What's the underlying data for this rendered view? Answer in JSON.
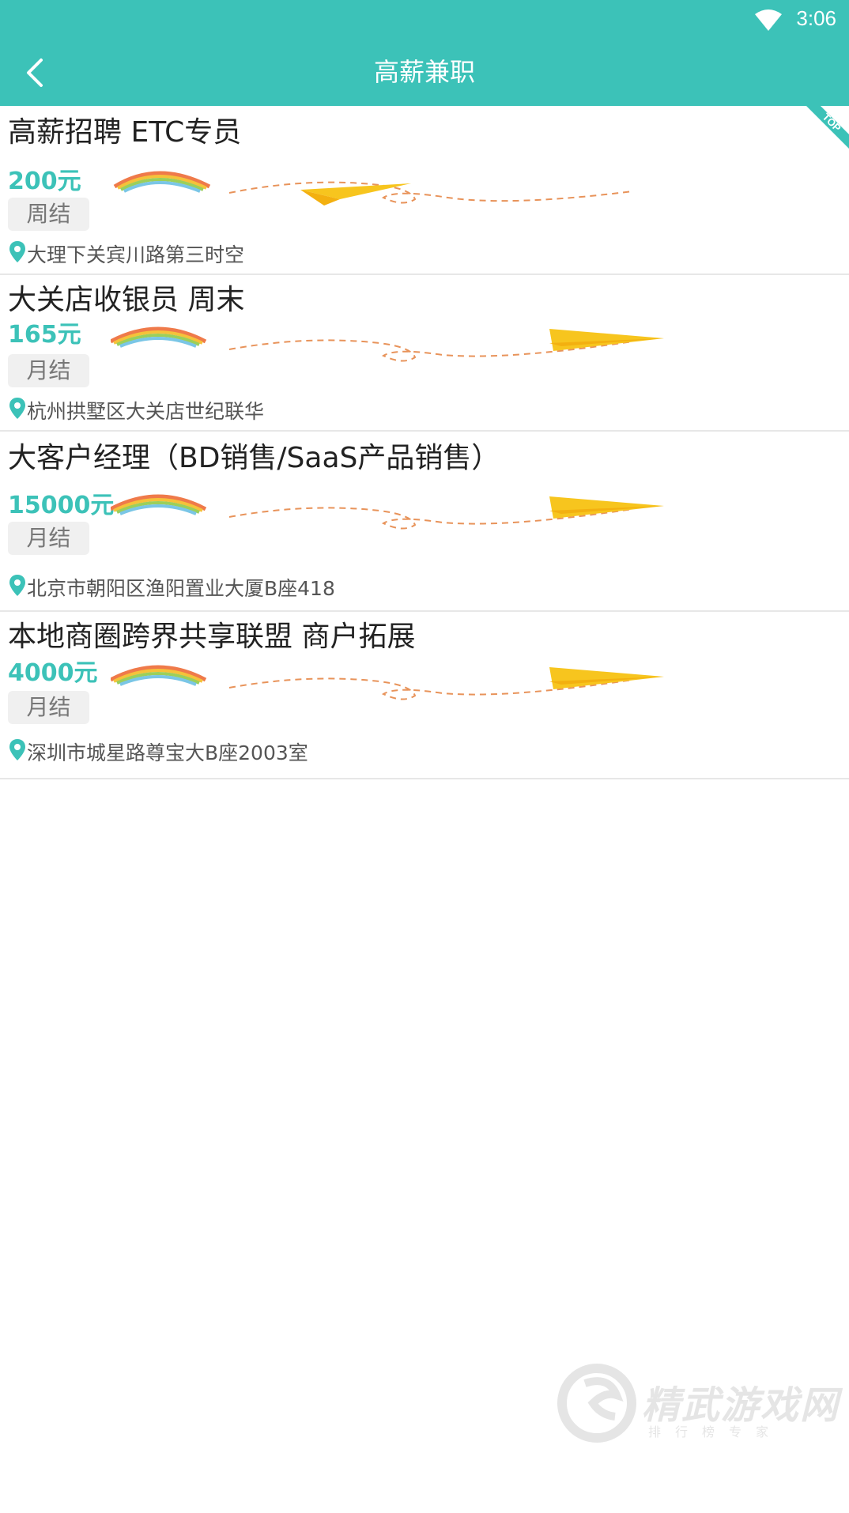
{
  "status_bar": {
    "time": "3:06"
  },
  "header": {
    "title": "高薪兼职"
  },
  "jobs": [
    {
      "title": "高薪招聘 ETC专员",
      "salary": "200元",
      "settlement": "周结",
      "address": "大理下关宾川路第三时空",
      "badge": "TOP"
    },
    {
      "title": "大关店收银员 周末",
      "salary": "165元",
      "settlement": "月结",
      "address": "杭州拱墅区大关店世纪联华"
    },
    {
      "title": "大客户经理（BD销售/SaaS产品销售）",
      "salary": "15000元",
      "settlement": "月结",
      "address": "北京市朝阳区渔阳置业大厦B座418"
    },
    {
      "title": "本地商圈跨界共享联盟 商户拓展",
      "salary": "4000元",
      "settlement": "月结",
      "address": "深圳市城星路尊宝大B座2003室"
    }
  ],
  "watermark": {
    "name": "精武游戏网",
    "tagline": "排行榜专家"
  },
  "colors": {
    "accent": "#3cc2b8",
    "divider": "#e7e7e7",
    "plane": "#f7c51e",
    "dash": "#e8935a"
  }
}
